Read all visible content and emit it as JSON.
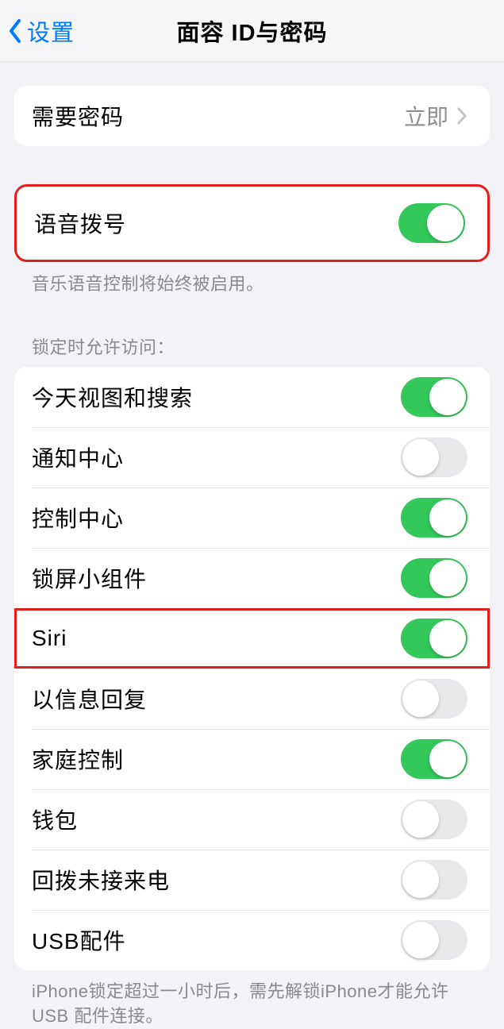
{
  "nav": {
    "back_label": "设置",
    "title": "面容 ID与密码"
  },
  "require_passcode": {
    "label": "需要密码",
    "value": "立即"
  },
  "voice_dial": {
    "label": "语音拨号",
    "footer": "音乐语音控制将始终被启用。"
  },
  "locked_access": {
    "header": "锁定时允许访问：",
    "items": [
      {
        "label": "今天视图和搜索",
        "on": true
      },
      {
        "label": "通知中心",
        "on": false
      },
      {
        "label": "控制中心",
        "on": true
      },
      {
        "label": "锁屏小组件",
        "on": true
      },
      {
        "label": "Siri",
        "on": true
      },
      {
        "label": "以信息回复",
        "on": false
      },
      {
        "label": "家庭控制",
        "on": true
      },
      {
        "label": "钱包",
        "on": false
      },
      {
        "label": "回拨未接来电",
        "on": false
      },
      {
        "label": "USB配件",
        "on": false
      }
    ],
    "footer": "iPhone锁定超过一小时后，需先解锁iPhone才能允许USB 配件连接。"
  }
}
